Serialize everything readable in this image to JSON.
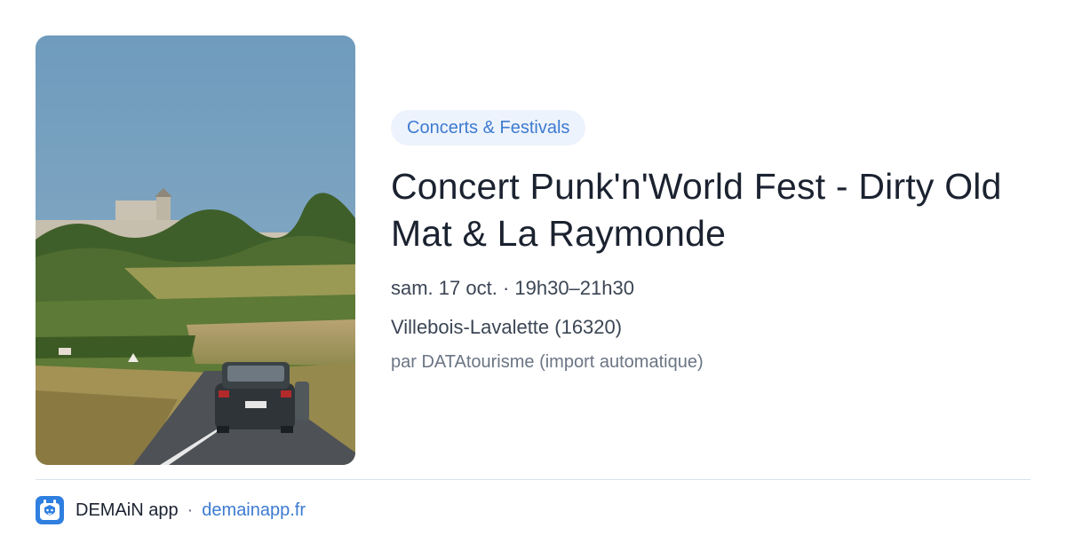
{
  "image": {
    "alt_icon": "landscape-photo"
  },
  "event": {
    "category": "Concerts & Festivals",
    "title": "Concert Punk'n'World Fest - Dirty Old Mat & La Raymonde",
    "date": "sam. 17 oct. · 19h30–21h30",
    "location": "Villebois-Lavalette (16320)",
    "source": "par DATAtourisme (import automatique)"
  },
  "footer": {
    "app_name": "DEMAiN app",
    "separator": "·",
    "domain": "demainapp.fr",
    "icon": "app-logo-icon"
  },
  "colors": {
    "accent": "#3d7bd1",
    "category_bg": "#edf3fc",
    "title": "#1b2230",
    "muted": "#6b7584",
    "divider": "#d7e2ea"
  }
}
